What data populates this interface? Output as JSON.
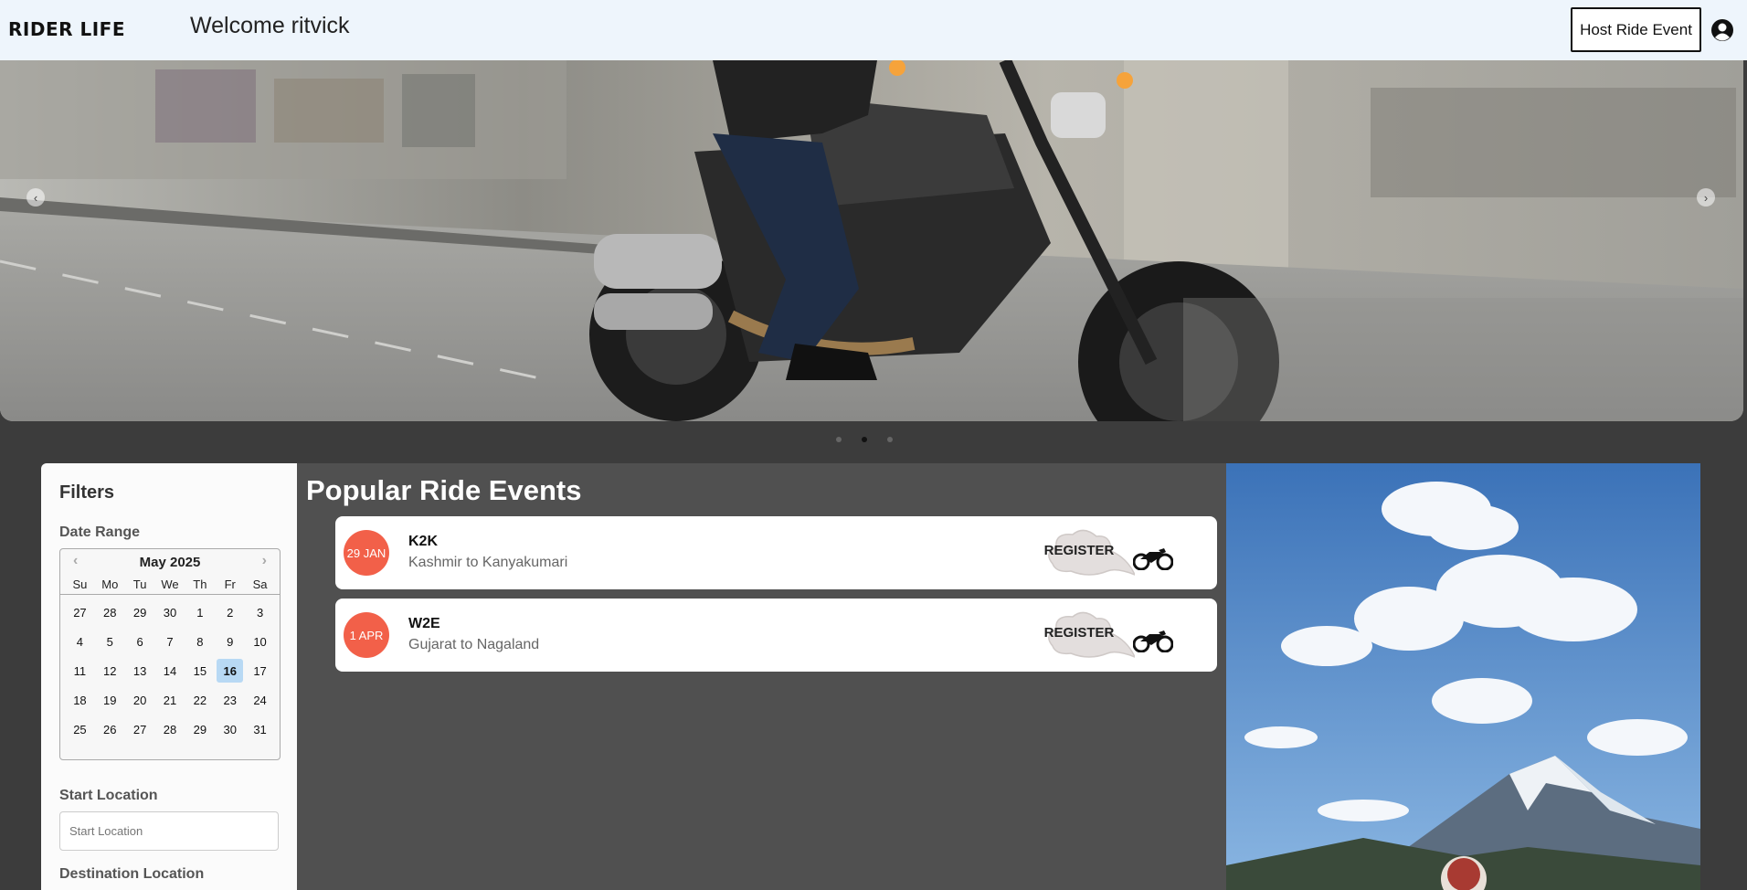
{
  "header": {
    "logo": "RIDER LIFE",
    "welcome": "Welcome ritvick",
    "host_button": "Host Ride Event",
    "user_icon": "user-circle-icon"
  },
  "hero": {
    "prev_icon": "chevron-left-icon",
    "next_icon": "chevron-right-icon",
    "prev_glyph": "‹",
    "next_glyph": "›",
    "slide_count": 3,
    "active_slide": 2
  },
  "filters": {
    "title": "Filters",
    "date_range_label": "Date Range",
    "calendar": {
      "month": "May 2025",
      "prev": "‹",
      "next": "›",
      "weekdays": [
        "Su",
        "Mo",
        "Tu",
        "We",
        "Th",
        "Fr",
        "Sa"
      ],
      "days": [
        "27",
        "28",
        "29",
        "30",
        "1",
        "2",
        "3",
        "4",
        "5",
        "6",
        "7",
        "8",
        "9",
        "10",
        "11",
        "12",
        "13",
        "14",
        "15",
        "16",
        "17",
        "18",
        "19",
        "20",
        "21",
        "22",
        "23",
        "24",
        "25",
        "26",
        "27",
        "28",
        "29",
        "30",
        "31"
      ],
      "selected": "16"
    },
    "start_location_label": "Start Location",
    "start_location_placeholder": "Start Location",
    "destination_label": "Destination Location"
  },
  "events": {
    "title": "Popular Ride Events",
    "items": [
      {
        "date": "29 JAN",
        "name": "K2K",
        "route": "Kashmir to Kanyakumari",
        "register": "REGISTER"
      },
      {
        "date": "1 APR",
        "name": "W2E",
        "route": "Gujarat to Nagaland",
        "register": "REGISTER"
      }
    ]
  },
  "colors": {
    "header_bg": "#eef5fc",
    "page_bg": "#3c3c3c",
    "events_bg": "#505050",
    "badge": "#f26049",
    "selected_day": "#b8d9f4"
  }
}
